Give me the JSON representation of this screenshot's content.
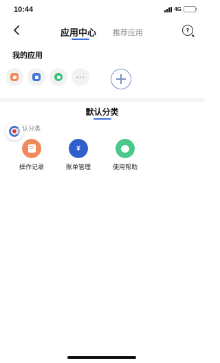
{
  "status_bar": {
    "time": "10:44",
    "network": "4G"
  },
  "nav": {
    "active_tab": "应用中心",
    "inactive_tab": "推荐应用"
  },
  "my_apps": {
    "title": "我的应用",
    "more": "···",
    "items": [
      {
        "icon": "record-icon",
        "color": "#f08a5d"
      },
      {
        "icon": "bill-icon",
        "color": "#3e74d6"
      },
      {
        "icon": "help-bubble-icon",
        "color": "#3ec27a"
      }
    ]
  },
  "default_category": {
    "title": "默认分类",
    "sub_label": "认分类",
    "apps": [
      {
        "label": "操作记录",
        "icon": "record-icon",
        "color": "#f08a5d"
      },
      {
        "label": "账单管理",
        "icon": "yen-icon",
        "color": "#2f5fc9"
      },
      {
        "label": "使用帮助",
        "icon": "help-bubble-icon",
        "color": "#49c88a"
      }
    ]
  },
  "colors": {
    "accent": "#3a6fd8"
  }
}
